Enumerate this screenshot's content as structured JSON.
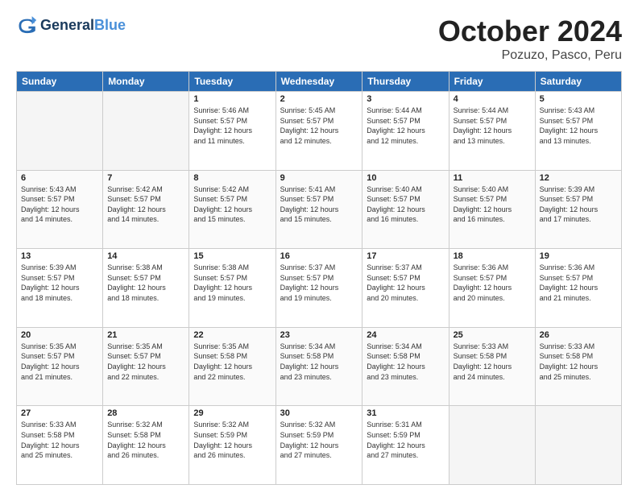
{
  "header": {
    "logo_line1": "General",
    "logo_line2": "Blue",
    "title": "October 2024",
    "subtitle": "Pozuzo, Pasco, Peru"
  },
  "days_of_week": [
    "Sunday",
    "Monday",
    "Tuesday",
    "Wednesday",
    "Thursday",
    "Friday",
    "Saturday"
  ],
  "weeks": [
    [
      {
        "day": "",
        "empty": true
      },
      {
        "day": "",
        "empty": true
      },
      {
        "day": "1",
        "sunrise": "5:46 AM",
        "sunset": "5:57 PM",
        "daylight": "12 hours and 11 minutes."
      },
      {
        "day": "2",
        "sunrise": "5:45 AM",
        "sunset": "5:57 PM",
        "daylight": "12 hours and 12 minutes."
      },
      {
        "day": "3",
        "sunrise": "5:44 AM",
        "sunset": "5:57 PM",
        "daylight": "12 hours and 12 minutes."
      },
      {
        "day": "4",
        "sunrise": "5:44 AM",
        "sunset": "5:57 PM",
        "daylight": "12 hours and 13 minutes."
      },
      {
        "day": "5",
        "sunrise": "5:43 AM",
        "sunset": "5:57 PM",
        "daylight": "12 hours and 13 minutes."
      }
    ],
    [
      {
        "day": "6",
        "sunrise": "5:43 AM",
        "sunset": "5:57 PM",
        "daylight": "12 hours and 14 minutes."
      },
      {
        "day": "7",
        "sunrise": "5:42 AM",
        "sunset": "5:57 PM",
        "daylight": "12 hours and 14 minutes."
      },
      {
        "day": "8",
        "sunrise": "5:42 AM",
        "sunset": "5:57 PM",
        "daylight": "12 hours and 15 minutes."
      },
      {
        "day": "9",
        "sunrise": "5:41 AM",
        "sunset": "5:57 PM",
        "daylight": "12 hours and 15 minutes."
      },
      {
        "day": "10",
        "sunrise": "5:40 AM",
        "sunset": "5:57 PM",
        "daylight": "12 hours and 16 minutes."
      },
      {
        "day": "11",
        "sunrise": "5:40 AM",
        "sunset": "5:57 PM",
        "daylight": "12 hours and 16 minutes."
      },
      {
        "day": "12",
        "sunrise": "5:39 AM",
        "sunset": "5:57 PM",
        "daylight": "12 hours and 17 minutes."
      }
    ],
    [
      {
        "day": "13",
        "sunrise": "5:39 AM",
        "sunset": "5:57 PM",
        "daylight": "12 hours and 18 minutes."
      },
      {
        "day": "14",
        "sunrise": "5:38 AM",
        "sunset": "5:57 PM",
        "daylight": "12 hours and 18 minutes."
      },
      {
        "day": "15",
        "sunrise": "5:38 AM",
        "sunset": "5:57 PM",
        "daylight": "12 hours and 19 minutes."
      },
      {
        "day": "16",
        "sunrise": "5:37 AM",
        "sunset": "5:57 PM",
        "daylight": "12 hours and 19 minutes."
      },
      {
        "day": "17",
        "sunrise": "5:37 AM",
        "sunset": "5:57 PM",
        "daylight": "12 hours and 20 minutes."
      },
      {
        "day": "18",
        "sunrise": "5:36 AM",
        "sunset": "5:57 PM",
        "daylight": "12 hours and 20 minutes."
      },
      {
        "day": "19",
        "sunrise": "5:36 AM",
        "sunset": "5:57 PM",
        "daylight": "12 hours and 21 minutes."
      }
    ],
    [
      {
        "day": "20",
        "sunrise": "5:35 AM",
        "sunset": "5:57 PM",
        "daylight": "12 hours and 21 minutes."
      },
      {
        "day": "21",
        "sunrise": "5:35 AM",
        "sunset": "5:57 PM",
        "daylight": "12 hours and 22 minutes."
      },
      {
        "day": "22",
        "sunrise": "5:35 AM",
        "sunset": "5:58 PM",
        "daylight": "12 hours and 22 minutes."
      },
      {
        "day": "23",
        "sunrise": "5:34 AM",
        "sunset": "5:58 PM",
        "daylight": "12 hours and 23 minutes."
      },
      {
        "day": "24",
        "sunrise": "5:34 AM",
        "sunset": "5:58 PM",
        "daylight": "12 hours and 23 minutes."
      },
      {
        "day": "25",
        "sunrise": "5:33 AM",
        "sunset": "5:58 PM",
        "daylight": "12 hours and 24 minutes."
      },
      {
        "day": "26",
        "sunrise": "5:33 AM",
        "sunset": "5:58 PM",
        "daylight": "12 hours and 25 minutes."
      }
    ],
    [
      {
        "day": "27",
        "sunrise": "5:33 AM",
        "sunset": "5:58 PM",
        "daylight": "12 hours and 25 minutes."
      },
      {
        "day": "28",
        "sunrise": "5:32 AM",
        "sunset": "5:58 PM",
        "daylight": "12 hours and 26 minutes."
      },
      {
        "day": "29",
        "sunrise": "5:32 AM",
        "sunset": "5:59 PM",
        "daylight": "12 hours and 26 minutes."
      },
      {
        "day": "30",
        "sunrise": "5:32 AM",
        "sunset": "5:59 PM",
        "daylight": "12 hours and 27 minutes."
      },
      {
        "day": "31",
        "sunrise": "5:31 AM",
        "sunset": "5:59 PM",
        "daylight": "12 hours and 27 minutes."
      },
      {
        "day": "",
        "empty": true
      },
      {
        "day": "",
        "empty": true
      }
    ]
  ]
}
